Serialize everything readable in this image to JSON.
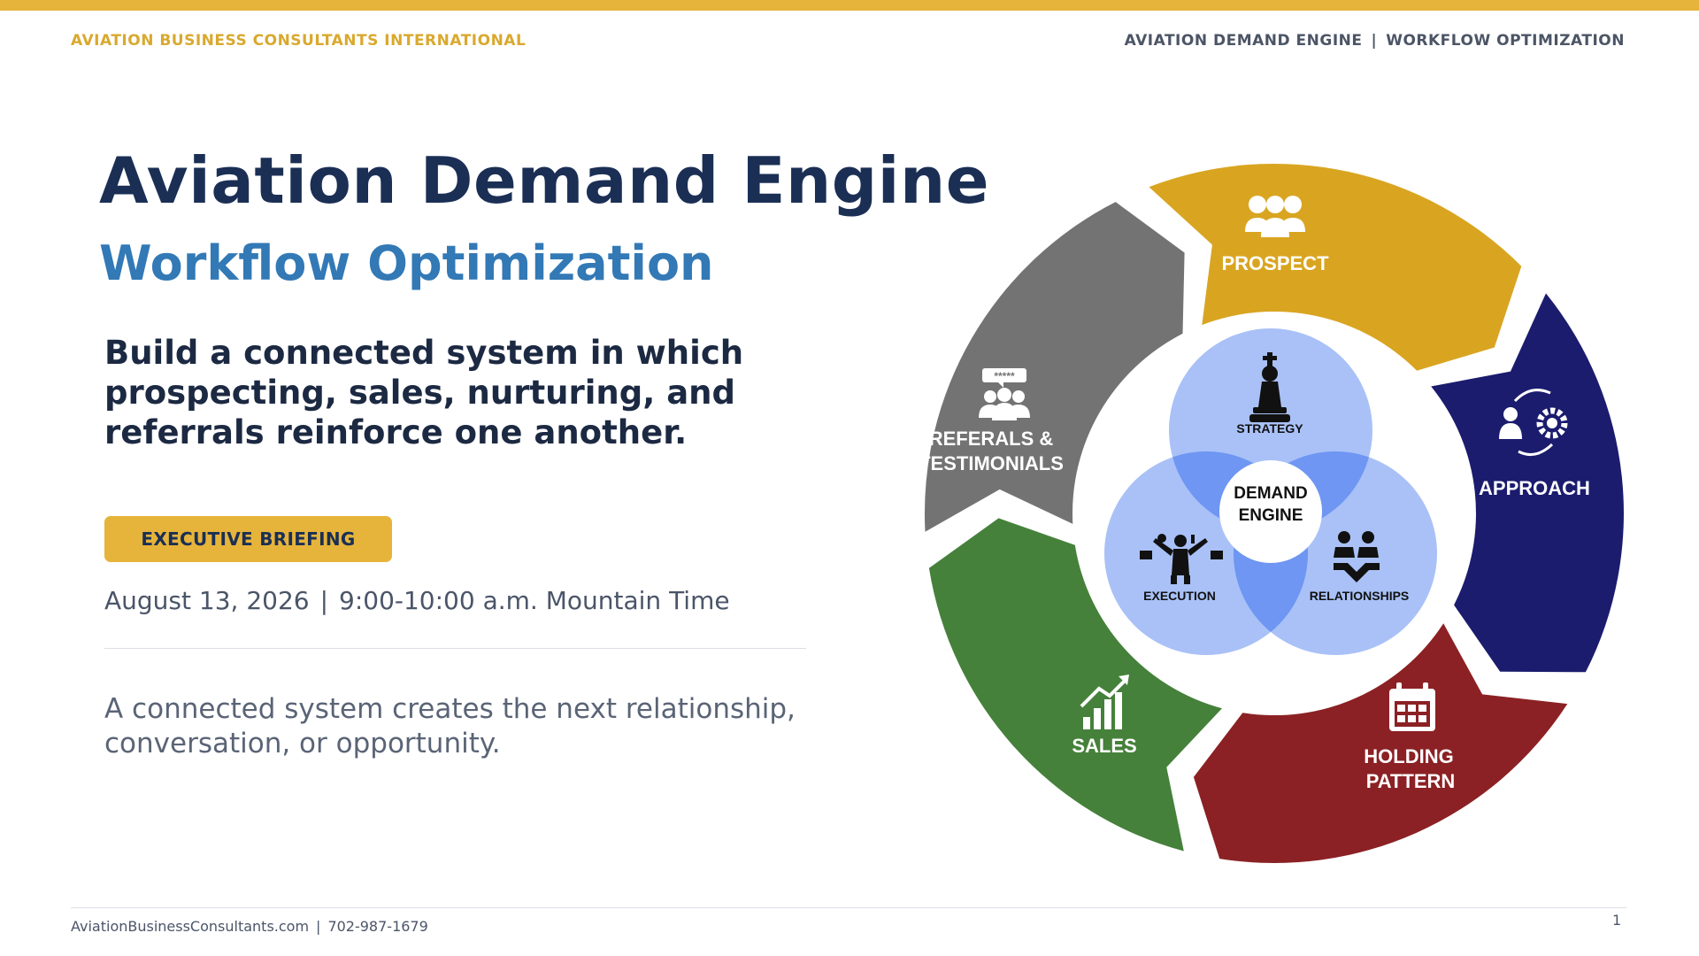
{
  "header": {
    "company": "AVIATION BUSINESS CONSULTANTS INTERNATIONAL",
    "program": "AVIATION DEMAND ENGINE",
    "separator": "|",
    "section": "WORKFLOW OPTIMIZATION"
  },
  "hero": {
    "title": "Aviation Demand Engine",
    "subtitle": "Workflow Optimization",
    "lead": "Build a connected system in which prospecting, sales, nurturing, and referrals reinforce one another."
  },
  "event": {
    "badge": "EXECUTIVE BRIEFING",
    "date": "August 13, 2026",
    "separator": "|",
    "time": "9:00-10:00 a.m. Mountain Time"
  },
  "closing": "A connected system creates the next relationship, conversation, or opportunity.",
  "footer": {
    "website": "AviationBusinessConsultants.com",
    "separator": "|",
    "phone": "702-987-1679",
    "page": "1"
  },
  "diagram": {
    "segments": [
      {
        "name": "prospect",
        "label": [
          "PROSPECT"
        ],
        "color": "#d9a521",
        "icon": "people-group-icon"
      },
      {
        "name": "approach",
        "label": [
          "APPROACH"
        ],
        "color": "#1b1c6e",
        "icon": "person-gear-icon"
      },
      {
        "name": "holding-pattern",
        "label": [
          "HOLDING",
          "PATTERN"
        ],
        "color": "#8b2124",
        "icon": "calendar-icon"
      },
      {
        "name": "sales",
        "label": [
          "SALES"
        ],
        "color": "#45813a",
        "icon": "chart-growth-icon"
      },
      {
        "name": "referrals",
        "label": [
          "REFERALS &",
          "TESTIMONIALS"
        ],
        "color": "#737373",
        "icon": "rating-group-icon"
      }
    ],
    "inner": {
      "strategy": "STRATEGY",
      "execution": "EXECUTION",
      "relationships": "RELATIONSHIPS",
      "center": [
        "DEMAND",
        "ENGINE"
      ],
      "circle_color": "#a9c1f7",
      "overlap_color": "#6e96f2"
    }
  }
}
